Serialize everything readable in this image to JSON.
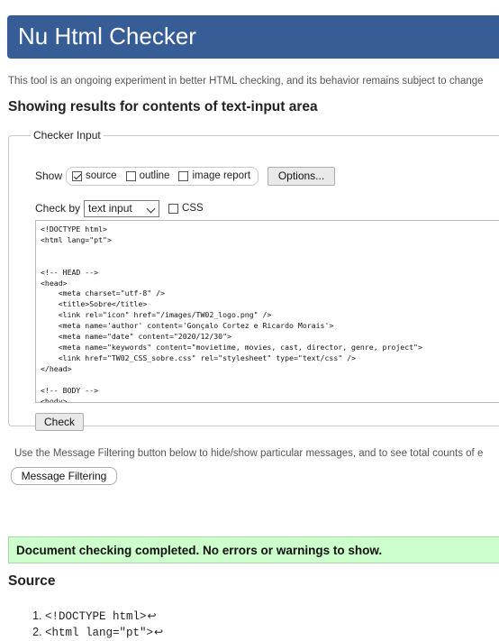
{
  "header": {
    "title": "Nu Html Checker"
  },
  "intro": "This tool is an ongoing experiment in better HTML checking, and its behavior remains subject to change",
  "results_title": "Showing results for contents of text-input area",
  "checker_input": {
    "legend": "Checker Input",
    "show_label": "Show",
    "show_options": [
      {
        "label": "source",
        "checked": true
      },
      {
        "label": "outline",
        "checked": false
      },
      {
        "label": "image report",
        "checked": false
      }
    ],
    "options_button": "Options...",
    "check_by_label": "Check by",
    "check_by_value": "text input",
    "css_label": "CSS",
    "css_checked": false,
    "textarea_content": "<!DOCTYPE html>\n<html lang=\"pt\">\n\n\n<!-- HEAD -->\n<head>\n    <meta charset=\"utf-8\" />\n    <title>Sobre</title>\n    <link rel=\"icon\" href=\"/images/TW02_logo.png\" />\n    <meta name='author' content='Gonçalo Cortez e Ricardo Morais'>\n    <meta name=\"date\" content=\"2020/12/30\">\n    <meta name=\"keywords\" content=\"movietime, movies, cast, director, genre, project\">\n    <link href=\"TW02_CSS_sobre.css\" rel=\"stylesheet\" type=\"text/css\" />\n</head>\n\n<!-- BODY -->\n<body>",
    "check_button": "Check"
  },
  "filter_note": "Use the Message Filtering button below to hide/show particular messages, and to see total counts of e",
  "filter_button": "Message Filtering",
  "status_message": "Document checking completed. No errors or warnings to show.",
  "source_title": "Source",
  "source_lines": [
    "<!DOCTYPE html>",
    "<html lang=\"pt\">"
  ],
  "return_glyph": "↩",
  "colors": {
    "header_bg": "#365d95",
    "success_bg": "#ccffcc"
  }
}
